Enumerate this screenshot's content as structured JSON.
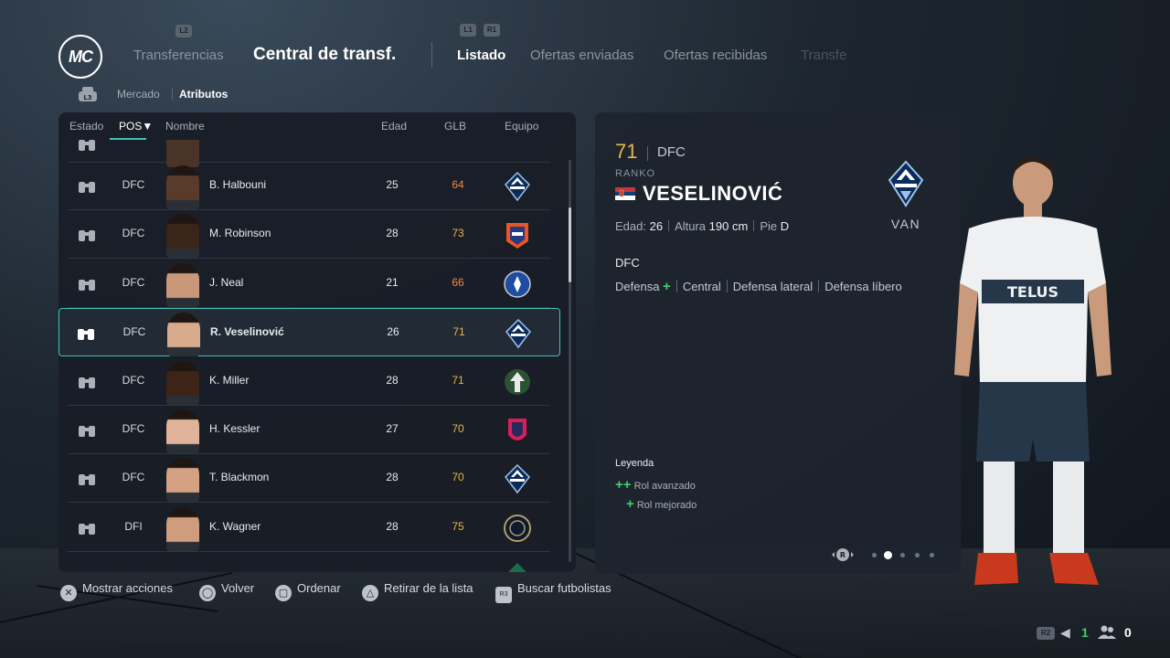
{
  "nav": {
    "logo": "MC",
    "left_hint": "L2",
    "hint_l1": "L1",
    "hint_r1": "R1",
    "transfers": "Transferencias",
    "title": "Central de transf.",
    "tabs": [
      "Listado",
      "Ofertas enviadas",
      "Ofertas recibidas",
      "Transfe"
    ],
    "l3": "L3"
  },
  "subnav": {
    "market": "Mercado",
    "attributes": "Atributos"
  },
  "list": {
    "headers": {
      "estado": "Estado",
      "pos": "POS▼",
      "nombre": "Nombre",
      "edad": "Edad",
      "glb": "GLB",
      "equipo": "Equipo"
    },
    "rows": [
      {
        "pos": "DFC",
        "name": "B. Halbouni",
        "age": "25",
        "glb": "64",
        "glb_color": "#f08a3a",
        "team": "van"
      },
      {
        "pos": "DFC",
        "name": "M. Robinson",
        "age": "28",
        "glb": "73",
        "glb_color": "#e8b64a",
        "team": "cin"
      },
      {
        "pos": "DFC",
        "name": "J. Neal",
        "age": "21",
        "glb": "66",
        "glb_color": "#f08a3a",
        "team": "mtl"
      },
      {
        "pos": "DFC",
        "name": "R. Veselinović",
        "age": "26",
        "glb": "71",
        "glb_color": "#e8b64a",
        "team": "van"
      },
      {
        "pos": "DFC",
        "name": "K. Miller",
        "age": "28",
        "glb": "71",
        "glb_color": "#e8b64a",
        "team": "por"
      },
      {
        "pos": "DFC",
        "name": "H. Kessler",
        "age": "27",
        "glb": "70",
        "glb_color": "#e8b64a",
        "team": "stl"
      },
      {
        "pos": "DFC",
        "name": "T. Blackmon",
        "age": "28",
        "glb": "70",
        "glb_color": "#e8b64a",
        "team": "van"
      },
      {
        "pos": "DFI",
        "name": "K. Wagner",
        "age": "28",
        "glb": "75",
        "glb_color": "#e8b64a",
        "team": "phi"
      }
    ]
  },
  "detail": {
    "ovr": "71",
    "position": "DFC",
    "first_name": "RANKO",
    "last_name": "VESELINOVIĆ",
    "club": "VAN",
    "age_label": "Edad:",
    "age": "26",
    "height_label": "Altura",
    "height": "190 cm",
    "foot_label": "Pie",
    "foot": "D",
    "role_position": "DFC",
    "roles": [
      "Defensa",
      "Central",
      "Defensa lateral",
      "Defensa líbero"
    ],
    "plus": "+",
    "double_plus": "++",
    "legend_title": "Leyenda",
    "legend_advanced": "Rol avanzado",
    "legend_improved": "Rol mejorado",
    "pager_button": "R"
  },
  "bottom": {
    "show_actions": "Mostrar acciones",
    "back": "Volver",
    "sort": "Ordenar",
    "remove": "Retirar de la lista",
    "search": "Buscar futbolistas",
    "r3": "R3",
    "r2": "R2",
    "count1": "1",
    "count2": "0"
  },
  "colors": {
    "accent": "#3fc2b8",
    "ovr_gold": "#e8b64a",
    "ovr_orange": "#f08a3a",
    "plus_green": "#3dd16a"
  }
}
